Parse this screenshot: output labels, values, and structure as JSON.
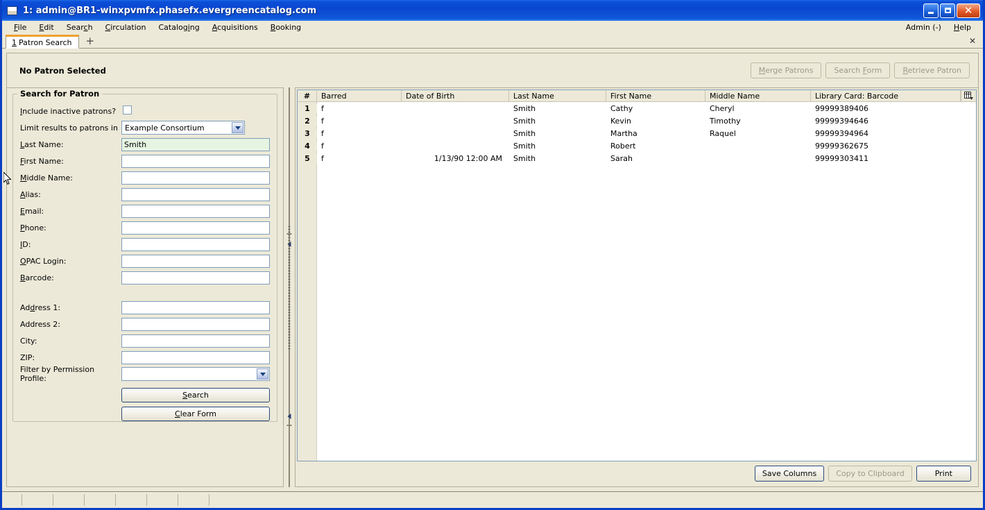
{
  "window": {
    "title": "1: admin@BR1-winxpvmfx.phasefx.evergreencatalog.com",
    "minimize_label": "Minimize",
    "maximize_label": "Maximize",
    "close_label": "✕"
  },
  "menubar": {
    "items": [
      {
        "label": "File",
        "mnemonic_index": 0
      },
      {
        "label": "Edit",
        "mnemonic_index": 0
      },
      {
        "label": "Search",
        "mnemonic_index": 4
      },
      {
        "label": "Circulation",
        "mnemonic_index": 0
      },
      {
        "label": "Cataloging",
        "mnemonic_index": 7
      },
      {
        "label": "Acquisitions",
        "mnemonic_index": 0
      },
      {
        "label": "Booking",
        "mnemonic_index": 0
      }
    ],
    "right_items": [
      {
        "label": "Admin (-)",
        "mnemonic_index": -1
      },
      {
        "label": "Help",
        "mnemonic_index": 0
      }
    ]
  },
  "tabbar": {
    "tabs": [
      {
        "number": "1",
        "label": "Patron Search"
      }
    ],
    "new_tab_label": "+",
    "close_label": "✕"
  },
  "patron_bar": {
    "status": "No Patron Selected",
    "buttons": [
      {
        "label": "Merge Patrons",
        "mnemonic_index": 0,
        "enabled": false
      },
      {
        "label": "Search Form",
        "mnemonic_index": 7,
        "enabled": false
      },
      {
        "label": "Retrieve Patron",
        "mnemonic_index": 0,
        "enabled": false
      }
    ]
  },
  "search_form": {
    "legend": "Search for Patron",
    "include_inactive": {
      "label": "Include inactive patrons?",
      "mnemonic_index": 0,
      "checked": false
    },
    "limit_results": {
      "label": "Limit results to patrons in",
      "value": "Example Consortium"
    },
    "fields": [
      {
        "label": "Last Name:",
        "mnemonic_index": 0,
        "value": "Smith",
        "focused": true
      },
      {
        "label": "First Name:",
        "mnemonic_index": 0,
        "value": "",
        "focused": false
      },
      {
        "label": "Middle Name:",
        "mnemonic_index": 0,
        "value": "",
        "focused": false
      },
      {
        "label": "Alias:",
        "mnemonic_index": 0,
        "value": "",
        "focused": false
      },
      {
        "label": "Email:",
        "mnemonic_index": 0,
        "value": "",
        "focused": false
      },
      {
        "label": "Phone:",
        "mnemonic_index": 0,
        "value": "",
        "focused": false
      },
      {
        "label": "ID:",
        "mnemonic_index": 0,
        "value": "",
        "focused": false
      },
      {
        "label": "OPAC Login:",
        "mnemonic_index": 0,
        "value": "",
        "focused": false
      },
      {
        "label": "Barcode:",
        "mnemonic_index": 0,
        "value": "",
        "focused": false
      }
    ],
    "address_fields": [
      {
        "label": "Address 1:",
        "mnemonic_index": 2,
        "value": ""
      },
      {
        "label": "Address 2:",
        "mnemonic_index": -1,
        "value": ""
      },
      {
        "label": "City:",
        "mnemonic_index": -1,
        "value": ""
      },
      {
        "label": "ZIP:",
        "mnemonic_index": -1,
        "value": ""
      }
    ],
    "permission_profile": {
      "label": "Filter by Permission Profile:",
      "value": ""
    },
    "search_button": {
      "label": "Search",
      "mnemonic_index": 0
    },
    "clear_button": {
      "label": "Clear Form",
      "mnemonic_index": 0
    }
  },
  "results": {
    "columns": [
      "#",
      "Barred",
      "Date of Birth",
      "Last Name",
      "First Name",
      "Middle Name",
      "Library Card: Barcode"
    ],
    "rows": [
      {
        "num": "1",
        "barred": "f",
        "dob": "",
        "last": "Smith",
        "first": "Cathy",
        "middle": "Cheryl",
        "card": "99999389406"
      },
      {
        "num": "2",
        "barred": "f",
        "dob": "",
        "last": "Smith",
        "first": "Kevin",
        "middle": "Timothy",
        "card": "99999394646"
      },
      {
        "num": "3",
        "barred": "f",
        "dob": "",
        "last": "Smith",
        "first": "Martha",
        "middle": "Raquel",
        "card": "99999394964"
      },
      {
        "num": "4",
        "barred": "f",
        "dob": "",
        "last": "Smith",
        "first": "Robert",
        "middle": "",
        "card": "99999362675"
      },
      {
        "num": "5",
        "barred": "f",
        "dob": "1/13/90 12:00 AM",
        "last": "Smith",
        "first": "Sarah",
        "middle": "",
        "card": "99999303411"
      }
    ],
    "footer_buttons": [
      {
        "label": "Save Columns",
        "enabled": true
      },
      {
        "label": "Copy to Clipboard",
        "enabled": false
      },
      {
        "label": "Print",
        "enabled": true
      }
    ]
  },
  "colors": {
    "titlebar_blue": "#0a46d0",
    "window_border": "#0a3fc4",
    "chrome_beige": "#ece9d8",
    "field_border": "#7f9db9",
    "filled_field_green": "#e6f5e2",
    "tab_accent_orange": "#f0a030",
    "disabled_text": "#9d9a8b"
  }
}
